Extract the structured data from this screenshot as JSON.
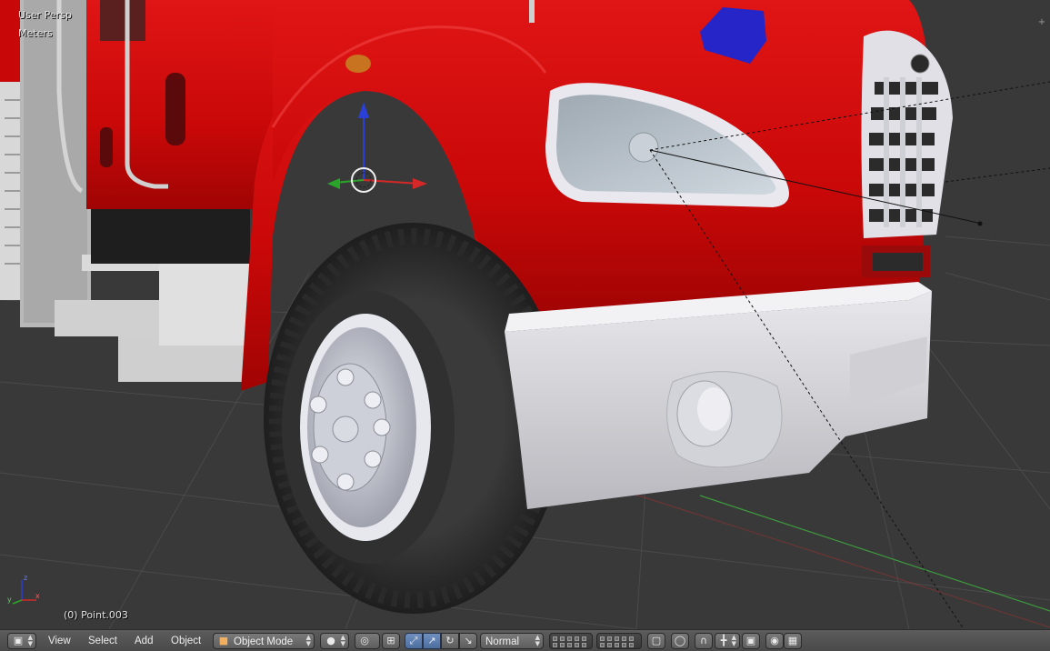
{
  "viewport": {
    "view_label": "User Persp",
    "units_label": "Meters",
    "active_object_label": "(0) Point.003",
    "axis_labels": {
      "z": "z",
      "x": "x",
      "y": "y"
    }
  },
  "toolbar": {
    "menu": {
      "view": "View",
      "select": "Select",
      "add": "Add",
      "object": "Object"
    },
    "mode_select": {
      "value": "Object Mode"
    },
    "orientation_select": {
      "value": "Normal"
    }
  },
  "colors": {
    "truck_red": "#cc0a0a",
    "grid_bg": "#393939",
    "x_axis": "#d62828",
    "y_axis": "#2aa52a",
    "z_axis": "#2a3fd6",
    "toolbar_bg": "#505050"
  },
  "icons": [
    "editor-type-icon",
    "object-mode-cube-icon",
    "viewport-shading-icon",
    "pivot-point-icon",
    "manipulator-icon",
    "translate-icon",
    "rotate-icon",
    "scale-icon",
    "layers-grid-icon",
    "lock-icon",
    "proportional-edit-icon",
    "snap-icon",
    "render-icon",
    "camera-icon",
    "clapperboard-icon"
  ]
}
